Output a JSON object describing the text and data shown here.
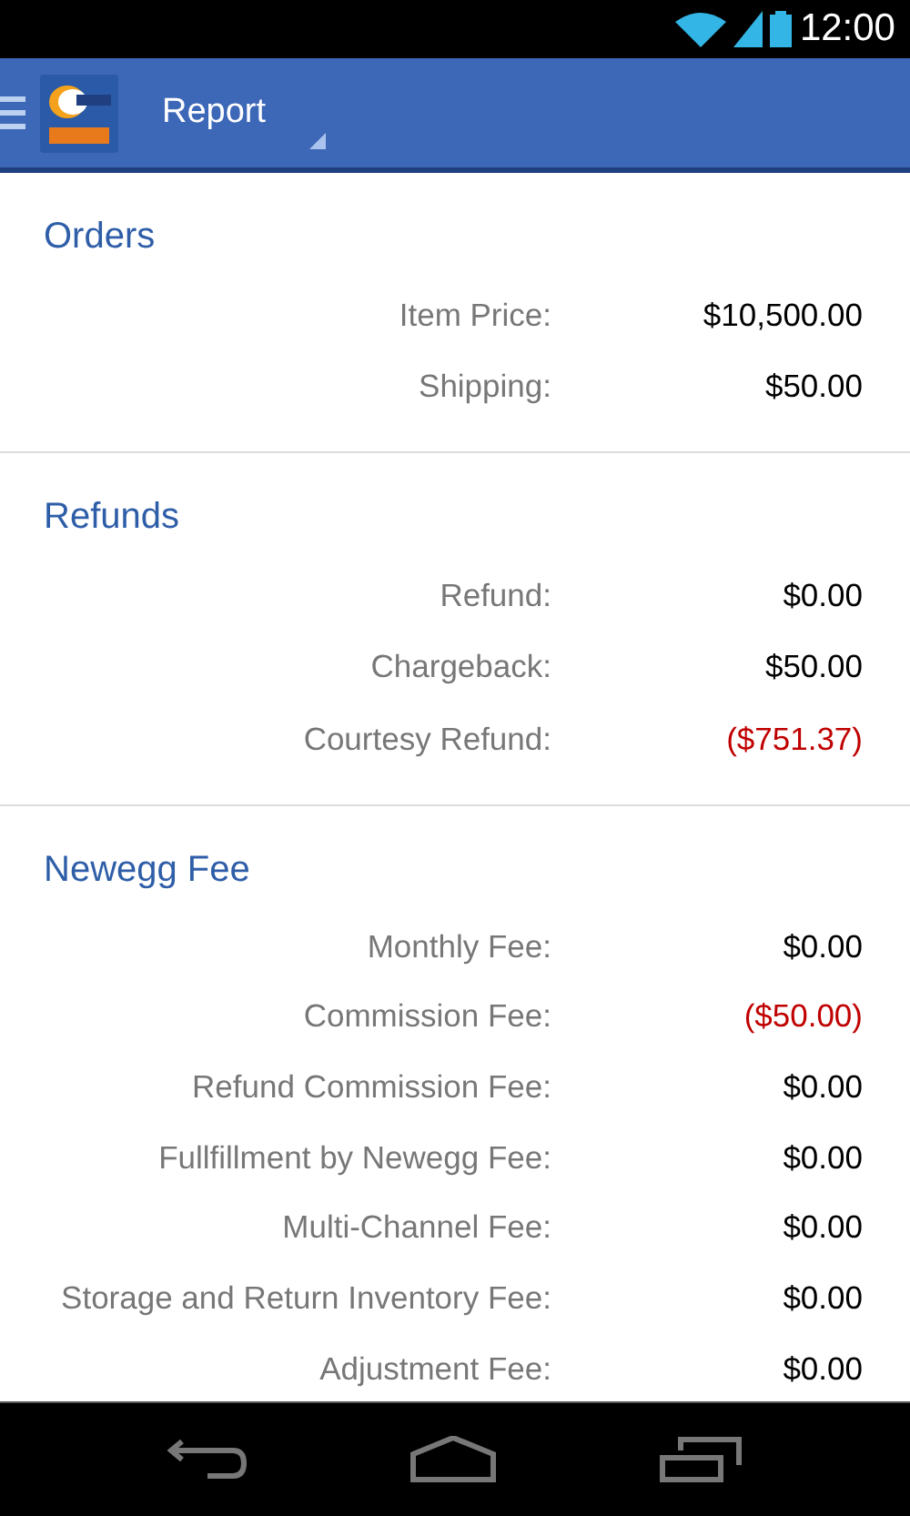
{
  "status_bar": {
    "time": "12:00"
  },
  "action_bar": {
    "title": "Report"
  },
  "sections": [
    {
      "title": "Orders",
      "rows": [
        {
          "label": "Item Price:",
          "value": "$10,500.00",
          "negative": false
        },
        {
          "label": "Shipping:",
          "value": "$50.00",
          "negative": false
        }
      ]
    },
    {
      "title": "Refunds",
      "rows": [
        {
          "label": "Refund:",
          "value": "$0.00",
          "negative": false
        },
        {
          "label": "Chargeback:",
          "value": "$50.00",
          "negative": false
        },
        {
          "label": "Courtesy Refund:",
          "value": "($751.37)",
          "negative": true
        }
      ]
    },
    {
      "title": "Newegg Fee",
      "rows": [
        {
          "label": "Monthly Fee:",
          "value": "$0.00",
          "negative": false
        },
        {
          "label": "Commission Fee:",
          "value": "($50.00)",
          "negative": true
        },
        {
          "label": "Refund Commission Fee:",
          "value": "$0.00",
          "negative": false
        },
        {
          "label": "Fullfillment by Newegg Fee:",
          "value": "$0.00",
          "negative": false
        },
        {
          "label": "Multi-Channel Fee:",
          "value": "$0.00",
          "negative": false
        },
        {
          "label": "Storage and Return Inventory Fee:",
          "value": "$0.00",
          "negative": false
        },
        {
          "label": "Adjustment Fee:",
          "value": "$0.00",
          "negative": false
        }
      ]
    }
  ]
}
